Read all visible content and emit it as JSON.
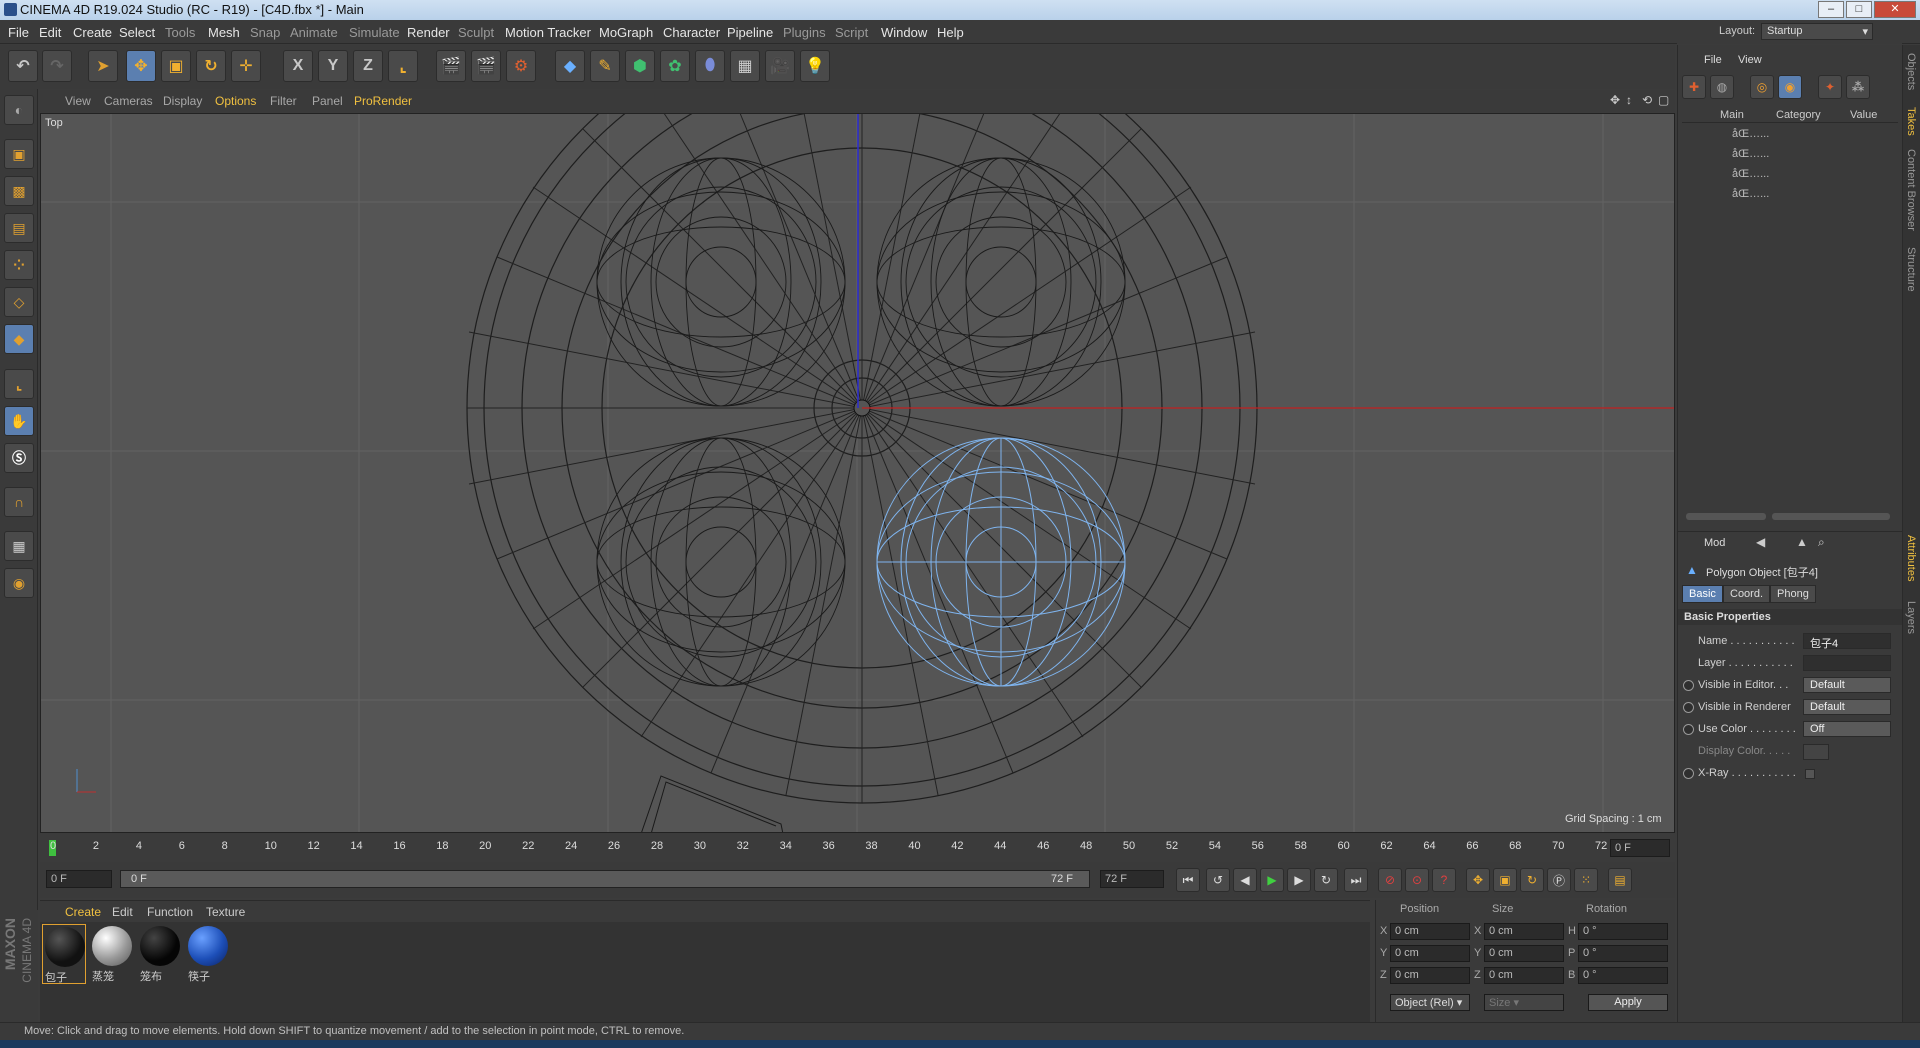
{
  "window": {
    "title": "CINEMA 4D R19.024 Studio (RC - R19) - [C4D.fbx *] - Main"
  },
  "menubar": {
    "items": [
      "File",
      "Edit",
      "Create",
      "Select",
      "Tools",
      "Mesh",
      "Snap",
      "Animate",
      "Simulate",
      "Render",
      "Sculpt",
      "Motion Tracker",
      "MoGraph",
      "Character",
      "Pipeline",
      "Plugins",
      "Script",
      "Window",
      "Help"
    ]
  },
  "layout": {
    "label": "Layout:",
    "value": "Startup"
  },
  "toolbar": {
    "axis_x": "X",
    "axis_y": "Y",
    "axis_z": "Z"
  },
  "viewport": {
    "menu": [
      "View",
      "Cameras",
      "Display",
      "Options",
      "Filter",
      "Panel",
      "ProRender"
    ],
    "active_menu": "Options",
    "camera_label": "Top",
    "grid_spacing": "Grid Spacing : 1 cm"
  },
  "timeline": {
    "ticks": [
      "0",
      "2",
      "4",
      "6",
      "8",
      "10",
      "12",
      "14",
      "16",
      "18",
      "20",
      "22",
      "24",
      "26",
      "28",
      "30",
      "32",
      "34",
      "36",
      "38",
      "40",
      "42",
      "44",
      "46",
      "48",
      "50",
      "52",
      "54",
      "56",
      "58",
      "60",
      "62",
      "64",
      "66",
      "68",
      "70",
      "72"
    ],
    "current_frame": "0 F",
    "start_field": "0 F",
    "range_start": "0 F",
    "range_end": "72 F",
    "end_field": "72 F"
  },
  "materials": {
    "menu": [
      "Create",
      "Edit",
      "Function",
      "Texture"
    ],
    "items": [
      {
        "label": "包子",
        "color": "#1a1a1a"
      },
      {
        "label": "蒸笼",
        "color": "#b8b8b8"
      },
      {
        "label": "笼布",
        "color": "#0f0f0f"
      },
      {
        "label": "筷子",
        "color": "#1d4fb8"
      }
    ]
  },
  "coords": {
    "headers": [
      "Position",
      "Size",
      "Rotation"
    ],
    "rows": [
      {
        "axis": "X",
        "pos": "0 cm",
        "saxis": "X",
        "size": "0 cm",
        "raxis": "H",
        "rot": "0 °"
      },
      {
        "axis": "Y",
        "pos": "0 cm",
        "saxis": "Y",
        "size": "0 cm",
        "raxis": "P",
        "rot": "0 °"
      },
      {
        "axis": "Z",
        "pos": "0 cm",
        "saxis": "Z",
        "size": "0 cm",
        "raxis": "B",
        "rot": "0 °"
      }
    ],
    "mode": "Object (Rel)",
    "size_mode": "Size",
    "apply": "Apply"
  },
  "status": {
    "text": "Move: Click and drag to move elements. Hold down SHIFT to quantize movement / add to the selection in point mode, CTRL to remove."
  },
  "objects_panel": {
    "menu": [
      "File",
      "View"
    ],
    "columns": [
      "Main",
      "Category",
      "Value"
    ],
    "rows": [
      "åŒ…...",
      "åŒ…...",
      "åŒ…...",
      "åŒ…..."
    ]
  },
  "attributes": {
    "mode_label": "Mod",
    "object_title": "Polygon Object [包子4]",
    "tabs": [
      "Basic",
      "Coord.",
      "Phong"
    ],
    "active_tab": "Basic",
    "section": "Basic Properties",
    "props": [
      {
        "label": "Name . . . . . . . . . . .",
        "value": "包子4",
        "radio": false
      },
      {
        "label": "Layer . . . . . . . . . . .",
        "value": "",
        "radio": false
      },
      {
        "label": "Visible in Editor. . .",
        "value": "Default",
        "radio": true
      },
      {
        "label": "Visible in Renderer",
        "value": "Default",
        "radio": true
      },
      {
        "label": "Use Color . . . . . . . .",
        "value": "Off",
        "radio": true
      },
      {
        "label": "Display Color. . . . .",
        "value": "",
        "radio": false
      },
      {
        "label": "X-Ray . . . . . . . . . . .",
        "value": "",
        "radio": true
      }
    ]
  },
  "side_tabs": [
    "Objects",
    "Takes",
    "Content Browser",
    "Structure",
    "Attributes",
    "Layers"
  ],
  "brand": {
    "maxon": "MAXON",
    "cinema": "CINEMA 4D"
  },
  "colors": {
    "accent": "#5b7fb0",
    "highlight": "#f0c040",
    "selection": "#7fb4ee"
  }
}
